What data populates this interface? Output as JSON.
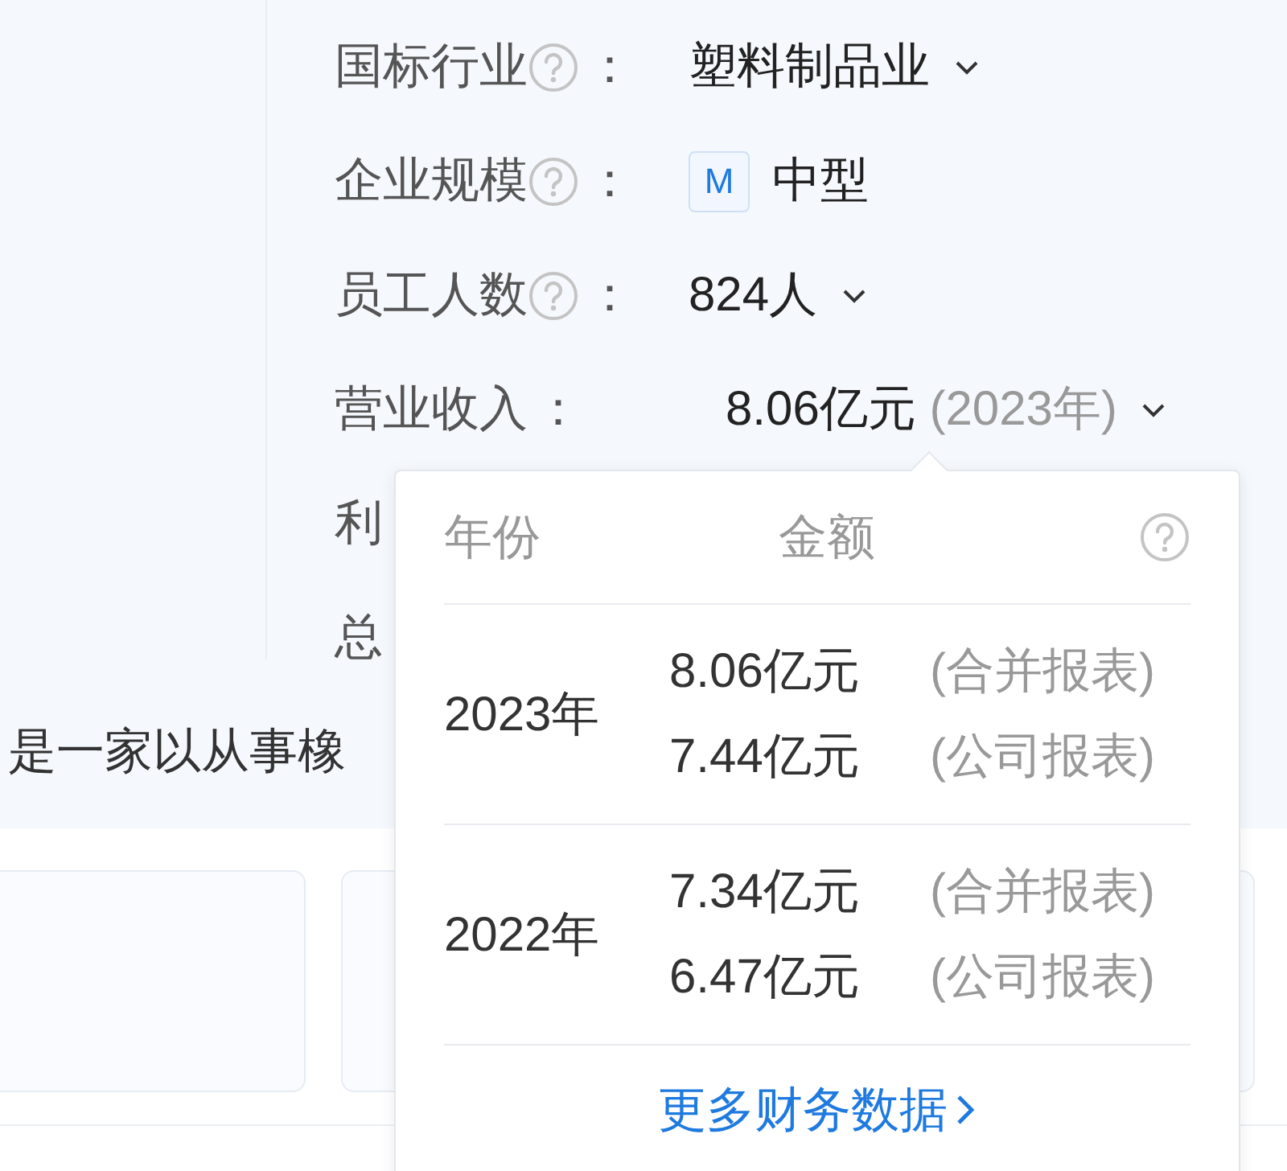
{
  "fields": [
    {
      "label": "国标行业",
      "help": true,
      "separator": "：",
      "value": "塑料制品业",
      "dropdown": true
    },
    {
      "label": "企业规模",
      "help": true,
      "separator": "：",
      "badge": "M",
      "value": "中型",
      "dropdown": false
    },
    {
      "label": "员工人数",
      "help": true,
      "separator": "：",
      "value": "824人",
      "dropdown": true
    },
    {
      "label": "营业收入",
      "help": false,
      "separator": "：",
      "value": "8.06亿元",
      "note": "(2023年)",
      "dropdown": true
    },
    {
      "label": "利"
    },
    {
      "label": "总"
    }
  ],
  "description": "是一家以从事橡",
  "popover": {
    "columns": [
      "年份",
      "金额"
    ],
    "help": true,
    "groups": [
      {
        "year": "2023年",
        "entries": [
          {
            "amount": "8.06亿元",
            "type": "(合并报表)"
          },
          {
            "amount": "7.44亿元",
            "type": "(公司报表)"
          }
        ]
      },
      {
        "year": "2022年",
        "entries": [
          {
            "amount": "7.34亿元",
            "type": "(合并报表)"
          },
          {
            "amount": "6.47亿元",
            "type": "(公司报表)"
          }
        ]
      }
    ],
    "more_link": "更多财务数据"
  }
}
